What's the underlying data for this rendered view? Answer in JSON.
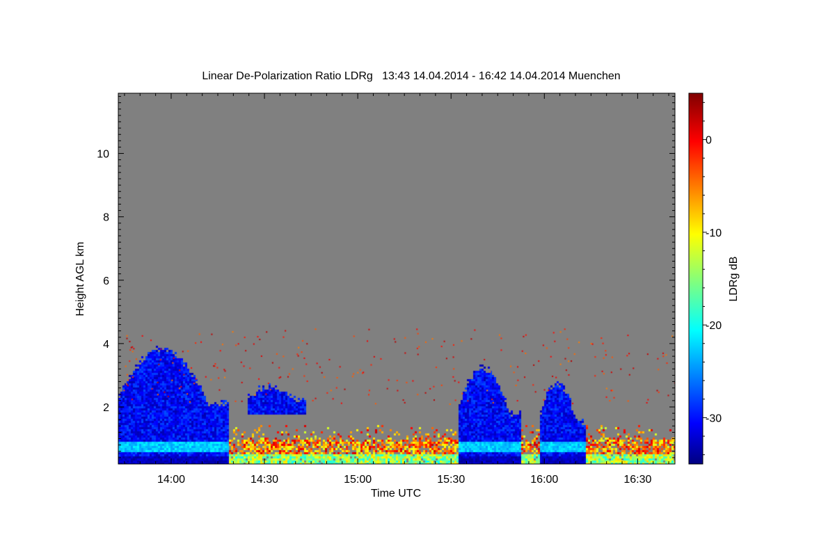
{
  "chart_data": {
    "type": "heatmap",
    "title": "Linear De-Polarization Ratio LDRg   13:43 14.04.2014 - 16:42 14.04.2014 Muenchen",
    "xlabel": "Time UTC",
    "ylabel": "Height AGL km",
    "colorbar_label": "LDRg dB",
    "x_range": [
      "13:43",
      "16:42"
    ],
    "y_range_km": [
      0.2,
      11.9
    ],
    "x_ticks": [
      {
        "label": "14:00",
        "minutes": 840
      },
      {
        "label": "14:30",
        "minutes": 870
      },
      {
        "label": "15:00",
        "minutes": 900
      },
      {
        "label": "15:30",
        "minutes": 930
      },
      {
        "label": "16:00",
        "minutes": 960
      },
      {
        "label": "16:30",
        "minutes": 990
      }
    ],
    "y_ticks": [
      {
        "label": "2",
        "value": 2
      },
      {
        "label": "4",
        "value": 4
      },
      {
        "label": "6",
        "value": 6
      },
      {
        "label": "8",
        "value": 8
      },
      {
        "label": "10",
        "value": 10
      }
    ],
    "colorbar_range_db": [
      -35,
      5
    ],
    "colorbar_ticks": [
      {
        "label": "0",
        "value": 0
      },
      {
        "label": "-10",
        "value": -10
      },
      {
        "label": "-20",
        "value": -20
      },
      {
        "label": "-30",
        "value": -30
      }
    ],
    "colormap": "jet",
    "no_data_color": "#808080",
    "features": [
      {
        "type": "cloud",
        "t_start": "13:43",
        "t_end": "14:18",
        "base_km": 0.2,
        "top_km": 4.0,
        "ldr_db": -30
      },
      {
        "type": "cloud",
        "t_start": "14:24",
        "t_end": "14:43",
        "base_km": 1.8,
        "top_km": 2.8,
        "ldr_db": -30
      },
      {
        "type": "cloud",
        "t_start": "15:32",
        "t_end": "15:52",
        "base_km": 0.2,
        "top_km": 3.4,
        "ldr_db": -30
      },
      {
        "type": "cloud",
        "t_start": "15:58",
        "t_end": "16:13",
        "base_km": 0.2,
        "top_km": 2.9,
        "ldr_db": -30
      },
      {
        "type": "aerosol_layer",
        "t_start": "14:08",
        "t_end": "16:42",
        "base_km": 0.2,
        "top_km": 1.8,
        "ldr_db": -10
      }
    ]
  }
}
